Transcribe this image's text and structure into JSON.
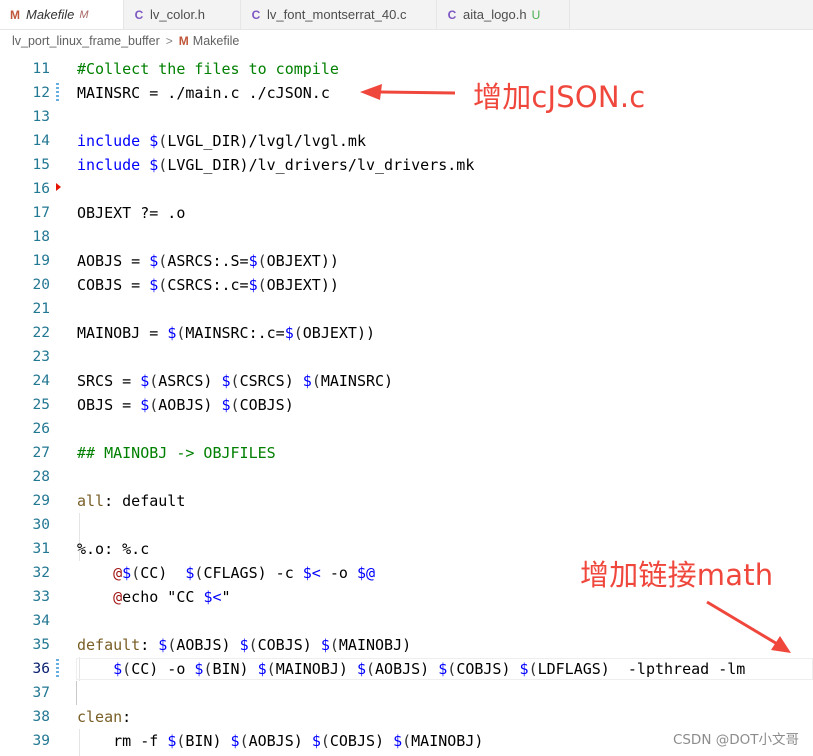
{
  "tabs": [
    {
      "label": "Makefile",
      "icon": "M",
      "badge": "M",
      "active": true
    },
    {
      "label": "lv_color.h",
      "icon": "C"
    },
    {
      "label": "lv_font_montserrat_40.c",
      "icon": "C"
    },
    {
      "label": "aita_logo.h",
      "icon": "C",
      "badge": "U"
    }
  ],
  "breadcrumb": {
    "folder": "lv_port_linux_frame_buffer",
    "separator": ">",
    "file_icon": "M",
    "file": "Makefile"
  },
  "lines": [
    {
      "num": "11",
      "text": "#Collect the files to compile"
    },
    {
      "num": "12",
      "text": "MAINSRC = ./main.c ./cJSON.c"
    },
    {
      "num": "13",
      "text": ""
    },
    {
      "num": "14",
      "text": "include $(LVGL_DIR)/lvgl/lvgl.mk"
    },
    {
      "num": "15",
      "text": "include $(LVGL_DIR)/lv_drivers/lv_drivers.mk"
    },
    {
      "num": "16",
      "text": ""
    },
    {
      "num": "17",
      "text": "OBJEXT ?= .o"
    },
    {
      "num": "18",
      "text": ""
    },
    {
      "num": "19",
      "text": "AOBJS = $(ASRCS:.S=$(OBJEXT))"
    },
    {
      "num": "20",
      "text": "COBJS = $(CSRCS:.c=$(OBJEXT))"
    },
    {
      "num": "21",
      "text": ""
    },
    {
      "num": "22",
      "text": "MAINOBJ = $(MAINSRC:.c=$(OBJEXT))"
    },
    {
      "num": "23",
      "text": ""
    },
    {
      "num": "24",
      "text": "SRCS = $(ASRCS) $(CSRCS) $(MAINSRC)"
    },
    {
      "num": "25",
      "text": "OBJS = $(AOBJS) $(COBJS)"
    },
    {
      "num": "26",
      "text": ""
    },
    {
      "num": "27",
      "text": "## MAINOBJ -> OBJFILES"
    },
    {
      "num": "28",
      "text": ""
    },
    {
      "num": "29",
      "text": "all: default"
    },
    {
      "num": "30",
      "text": ""
    },
    {
      "num": "31",
      "text": "%.o: %.c"
    },
    {
      "num": "32",
      "text": "    @$(CC)  $(CFLAGS) -c $< -o $@"
    },
    {
      "num": "33",
      "text": "    @echo \"CC $<\""
    },
    {
      "num": "34",
      "text": ""
    },
    {
      "num": "35",
      "text": "default: $(AOBJS) $(COBJS) $(MAINOBJ)"
    },
    {
      "num": "36",
      "text": "    $(CC) -o $(BIN) $(MAINOBJ) $(AOBJS) $(COBJS) $(LDFLAGS)  -lpthread -lm"
    },
    {
      "num": "37",
      "text": ""
    },
    {
      "num": "38",
      "text": "clean:"
    },
    {
      "num": "39",
      "text": "    rm -f $(BIN) $(AOBJS) $(COBJS) $(MAINOBJ)"
    }
  ],
  "annotations": {
    "cjson": "增加cJSON.c",
    "math": "增加链接math"
  },
  "watermark": "CSDN @DOT小文哥",
  "colors": {
    "annotation": "#f0473d",
    "keyword": "#0000ff",
    "comment": "#008000",
    "line_number": "#237893"
  }
}
